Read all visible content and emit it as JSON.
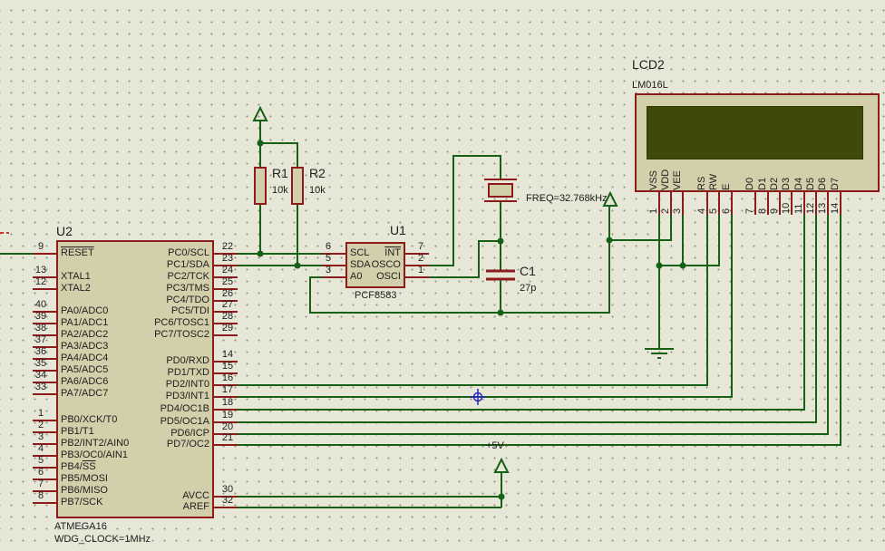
{
  "colors": {
    "background": "#E7E7D8",
    "wire_green": "#166116",
    "component_red": "#8E1B1B",
    "component_fill": "#D3CFAB",
    "lcd_screen": "#3E4A0B",
    "origin_marker_blue": "#2A2AB8"
  },
  "schematic": {
    "u2": {
      "ref": "U2",
      "part": "ATMEGA16",
      "property": "WDG_CLOCK=1MHz",
      "left_pins": [
        {
          "num": "9",
          "label": "RESET",
          "ov": "RESET"
        },
        {
          "num": "13",
          "label": "XTAL1"
        },
        {
          "num": "12",
          "label": "XTAL2"
        },
        {
          "num": "40",
          "label": "PA0/ADC0"
        },
        {
          "num": "39",
          "label": "PA1/ADC1"
        },
        {
          "num": "38",
          "label": "PA2/ADC2"
        },
        {
          "num": "37",
          "label": "PA3/ADC3"
        },
        {
          "num": "36",
          "label": "PA4/ADC4"
        },
        {
          "num": "35",
          "label": "PA5/ADC5"
        },
        {
          "num": "34",
          "label": "PA6/ADC6"
        },
        {
          "num": "33",
          "label": "PA7/ADC7"
        },
        {
          "num": "1",
          "label": "PB0/XCK/T0"
        },
        {
          "num": "2",
          "label": "PB1/T1"
        },
        {
          "num": "3",
          "label": "PB2/INT2/AIN0"
        },
        {
          "num": "4",
          "label": "PB3/OC0/AIN1"
        },
        {
          "num": "5",
          "label": "PB4/SS",
          "ov": "SS"
        },
        {
          "num": "6",
          "label": "PB5/MOSI"
        },
        {
          "num": "7",
          "label": "PB6/MISO"
        },
        {
          "num": "8",
          "label": "PB7/SCK"
        }
      ],
      "right_pins": [
        {
          "num": "22",
          "label": "PC0/SCL"
        },
        {
          "num": "23",
          "label": "PC1/SDA"
        },
        {
          "num": "24",
          "label": "PC2/TCK"
        },
        {
          "num": "25",
          "label": "PC3/TMS"
        },
        {
          "num": "26",
          "label": "PC4/TDO"
        },
        {
          "num": "27",
          "label": "PC5/TDI"
        },
        {
          "num": "28",
          "label": "PC6/TOSC1"
        },
        {
          "num": "29",
          "label": "PC7/TOSC2"
        },
        {
          "num": "14",
          "label": "PD0/RXD"
        },
        {
          "num": "15",
          "label": "PD1/TXD"
        },
        {
          "num": "16",
          "label": "PD2/INT0"
        },
        {
          "num": "17",
          "label": "PD3/INT1"
        },
        {
          "num": "18",
          "label": "PD4/OC1B"
        },
        {
          "num": "19",
          "label": "PD5/OC1A"
        },
        {
          "num": "20",
          "label": "PD6/ICP"
        },
        {
          "num": "21",
          "label": "PD7/OC2"
        },
        {
          "num": "30",
          "label": "AVCC"
        },
        {
          "num": "32",
          "label": "AREF"
        }
      ]
    },
    "u1": {
      "ref": "U1",
      "part": "PCF8583",
      "left_pins": [
        {
          "num": "6",
          "label": "SCL"
        },
        {
          "num": "5",
          "label": "SDA"
        },
        {
          "num": "3",
          "label": "A0"
        }
      ],
      "right_pins": [
        {
          "num": "7",
          "label": "INT",
          "ov": "INT"
        },
        {
          "num": "2",
          "label": "OSCO"
        },
        {
          "num": "1",
          "label": "OSCI"
        }
      ]
    },
    "lcd2": {
      "ref": "LCD2",
      "part": "LM016L",
      "pins": [
        {
          "num": "1",
          "label": "VSS"
        },
        {
          "num": "2",
          "label": "VDD"
        },
        {
          "num": "3",
          "label": "VEE"
        },
        {
          "num": "4",
          "label": "RS"
        },
        {
          "num": "5",
          "label": "RW"
        },
        {
          "num": "6",
          "label": "E"
        },
        {
          "num": "7",
          "label": "D0"
        },
        {
          "num": "8",
          "label": "D1"
        },
        {
          "num": "9",
          "label": "D2"
        },
        {
          "num": "10",
          "label": "D3"
        },
        {
          "num": "11",
          "label": "D4"
        },
        {
          "num": "12",
          "label": "D5"
        },
        {
          "num": "13",
          "label": "D6"
        },
        {
          "num": "14",
          "label": "D7"
        }
      ]
    },
    "r1": {
      "ref": "R1",
      "value": "10k"
    },
    "r2": {
      "ref": "R2",
      "value": "10k"
    },
    "c1": {
      "ref": "C1",
      "value": "27p"
    },
    "crystal": {
      "freq_label": "FREQ=32.768kHz"
    },
    "power": {
      "plus5v_label": "+5V"
    }
  }
}
